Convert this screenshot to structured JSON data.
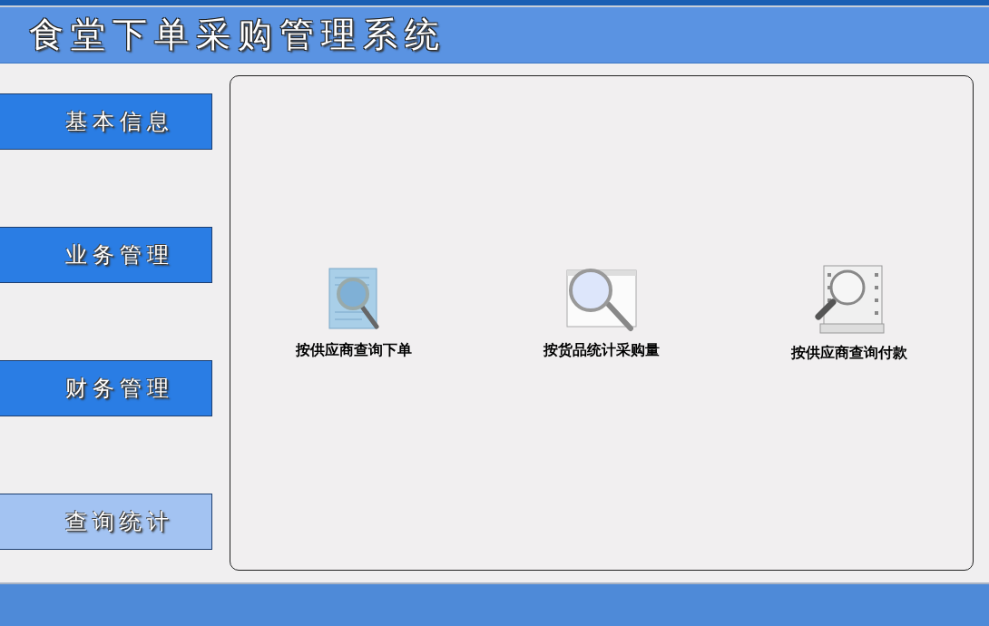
{
  "header": {
    "title": "食堂下单采购管理系统"
  },
  "sidebar": {
    "items": [
      {
        "label": "基本信息",
        "selected": false
      },
      {
        "label": "业务管理",
        "selected": false
      },
      {
        "label": "财务管理",
        "selected": false
      },
      {
        "label": "查询统计",
        "selected": true
      }
    ]
  },
  "panel": {
    "items": [
      {
        "label": "按供应商查询下单"
      },
      {
        "label": "按货品统计采购量"
      },
      {
        "label": "按供应商查询付款"
      }
    ]
  }
}
